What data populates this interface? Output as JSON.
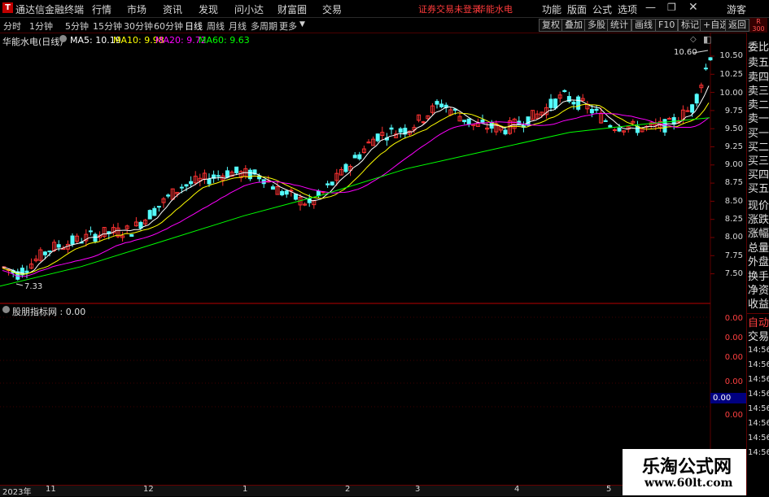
{
  "titlebar": {
    "app_name": "通达信金融终端",
    "menus": [
      "行情",
      "市场",
      "资讯",
      "发现",
      "问小达",
      "财富圈",
      "交易"
    ],
    "status": "证券交易未登录",
    "stock": "华能水电",
    "tools": [
      "功能",
      "版面",
      "公式",
      "选项"
    ],
    "guest": "游客"
  },
  "periodbar": {
    "items": [
      "分时",
      "1分钟",
      "5分钟",
      "15分钟",
      "30分钟",
      "60分钟",
      "日线",
      "周线",
      "月线",
      "多周期",
      "更多"
    ],
    "active": "日线",
    "right_buttons": [
      "复权",
      "叠加",
      "多股",
      "统计",
      "画线",
      "F10",
      "标记",
      "+自选",
      "返回"
    ]
  },
  "chart_header": {
    "title": "华能水电(日线)",
    "ma5": "MA5: 10.19",
    "ma10": "MA10: 9.98",
    "ma20": "MA20: 9.72",
    "ma60": "MA60: 9.63"
  },
  "annotations": {
    "high": "10.60",
    "low": "7.33"
  },
  "y_axis": [
    "10.50",
    "10.25",
    "10.00",
    "9.75",
    "9.50",
    "9.25",
    "9.00",
    "8.75",
    "8.50",
    "8.25",
    "8.00",
    "7.75",
    "7.50"
  ],
  "sub_chart": {
    "title": "股朋指标网 : 0.00",
    "y_axis": [
      "0.00",
      "0.00",
      "0.00",
      "0.00",
      "0.00"
    ],
    "current_value": "0.00"
  },
  "right_panel": {
    "badge": "R",
    "badge_num": "300",
    "items": [
      "委比",
      "卖五",
      "卖四",
      "卖三",
      "卖二",
      "卖一",
      "买一",
      "买二",
      "买三",
      "买四",
      "买五",
      "现价",
      "涨跌",
      "涨幅",
      "总量",
      "外盘",
      "换手",
      "净资",
      "收益"
    ],
    "auto_label": "自动",
    "trade_label": "交易",
    "times": [
      "14:56",
      "14:56",
      "14:56",
      "14:56",
      "14:56",
      "14:56",
      "14:56",
      "14:56"
    ]
  },
  "footer": {
    "labels": [
      "2023年",
      "11",
      "12",
      "1",
      "2",
      "3",
      "4",
      "5"
    ]
  },
  "watermark": {
    "line1": "乐淘公式网",
    "line2": "www.60lt.com"
  },
  "colors": {
    "up": "#ff3232",
    "down": "#54fcfc",
    "ma5": "#ffffff",
    "ma10": "#ffff00",
    "ma20": "#ff00ff",
    "ma60": "#00ff00"
  }
}
